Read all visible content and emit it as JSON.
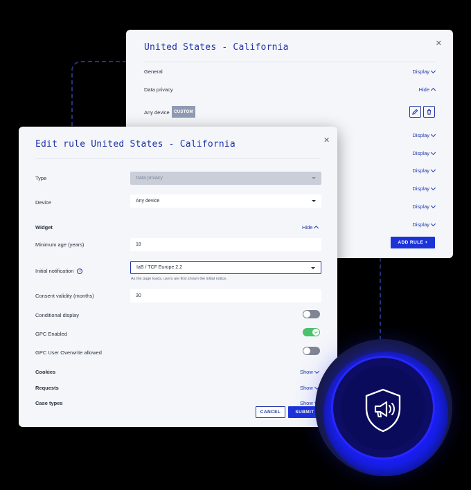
{
  "back_card": {
    "title": "United States - California",
    "sections": [
      {
        "label": "General",
        "toggle": "Display"
      },
      {
        "label": "Data privacy",
        "toggle": "Hide"
      }
    ],
    "device_row": {
      "label": "Any device",
      "tag": "CUSTOM"
    },
    "display_links": [
      "Display",
      "Display",
      "Display",
      "Display",
      "Display",
      "Display"
    ],
    "add_rule_label": "ADD RULE +"
  },
  "front_card": {
    "title": "Edit rule United States - California",
    "fields": {
      "type": {
        "label": "Type",
        "value": "Data privacy"
      },
      "device": {
        "label": "Device",
        "value": "Any device"
      }
    },
    "widget": {
      "label": "Widget",
      "toggle": "Hide"
    },
    "min_age": {
      "label": "Minimum age (years)",
      "value": "18"
    },
    "initial_notification": {
      "label": "Initial notification",
      "value": "IaB / TCF Europe 2.2",
      "helper": "As the page loads, users are first shown the initial notice."
    },
    "consent_validity": {
      "label": "Consent validity (months)",
      "value": "30"
    },
    "switches": {
      "conditional_display": {
        "label": "Conditional display",
        "on": false
      },
      "gpc_enabled": {
        "label": "GPC Enabled",
        "on": true
      },
      "gpc_overwrite": {
        "label": "GPC User Overwrite allowed",
        "on": false
      }
    },
    "collapsibles": [
      {
        "label": "Cookies",
        "toggle": "Show"
      },
      {
        "label": "Requests",
        "toggle": "Show"
      },
      {
        "label": "Case types",
        "toggle": "Show"
      }
    ],
    "cancel_label": "CANCEL",
    "submit_label": "SUBMIT"
  },
  "colors": {
    "accent": "#1c33d8",
    "title_blue": "#2036a8",
    "switch_on": "#4cc06a",
    "badge_blue": "#1414ff"
  },
  "icons": {
    "close": "close-icon",
    "edit": "pencil-icon",
    "delete": "trash-icon",
    "info": "info-icon",
    "badge": "shield-megaphone-icon"
  }
}
